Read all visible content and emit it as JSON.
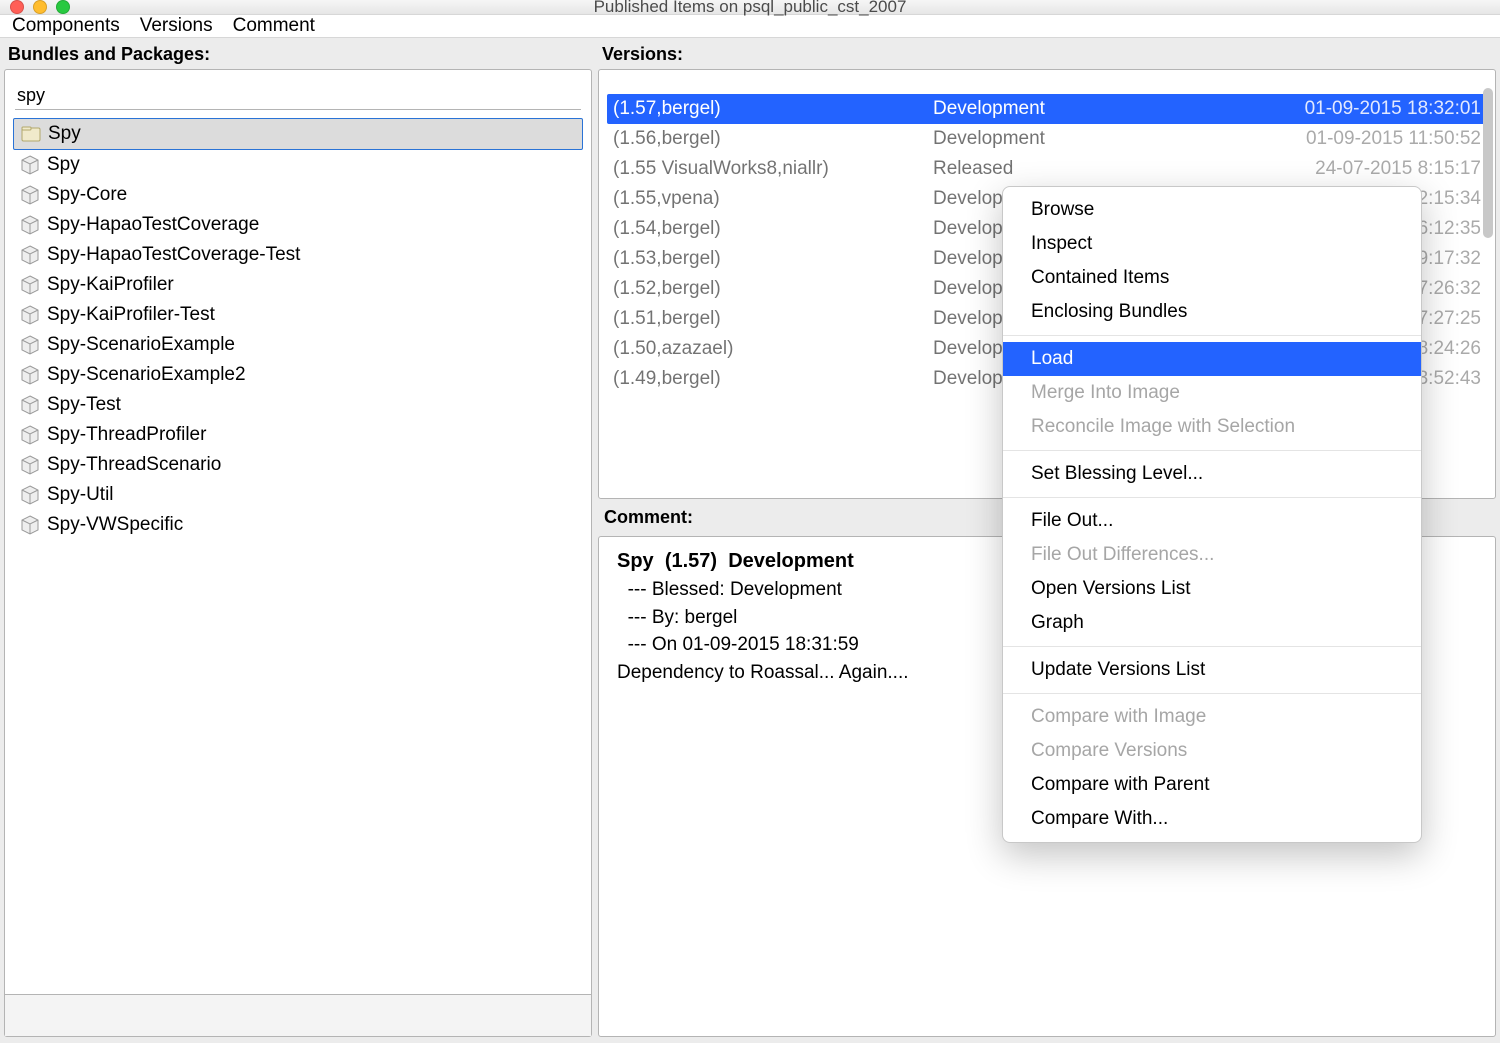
{
  "window": {
    "title": "Published Items on psql_public_cst_2007"
  },
  "menubar": [
    "Components",
    "Versions",
    "Comment"
  ],
  "labels": {
    "bundles": "Bundles and Packages:",
    "versions": "Versions:",
    "comment": "Comment:"
  },
  "search": {
    "value": "spy"
  },
  "packages": [
    {
      "name": "Spy",
      "type": "bundle",
      "selected": true
    },
    {
      "name": "Spy",
      "type": "package"
    },
    {
      "name": "Spy-Core",
      "type": "package"
    },
    {
      "name": "Spy-HapaoTestCoverage",
      "type": "package"
    },
    {
      "name": "Spy-HapaoTestCoverage-Test",
      "type": "package"
    },
    {
      "name": "Spy-KaiProfiler",
      "type": "package"
    },
    {
      "name": "Spy-KaiProfiler-Test",
      "type": "package"
    },
    {
      "name": "Spy-ScenarioExample",
      "type": "package"
    },
    {
      "name": "Spy-ScenarioExample2",
      "type": "package"
    },
    {
      "name": "Spy-Test",
      "type": "package"
    },
    {
      "name": "Spy-ThreadProfiler",
      "type": "package"
    },
    {
      "name": "Spy-ThreadScenario",
      "type": "package"
    },
    {
      "name": "Spy-Util",
      "type": "package"
    },
    {
      "name": "Spy-VWSpecific",
      "type": "package"
    }
  ],
  "versions": [
    {
      "label": "(1.57,bergel)",
      "blessing": "Development",
      "timestamp": "01-09-2015 18:32:01",
      "selected": true,
      "behind": false
    },
    {
      "label": "(1.56,bergel)",
      "blessing": "Development",
      "timestamp": "01-09-2015 11:50:52",
      "behind": true
    },
    {
      "label": "(1.55 VisualWorks8,niallr)",
      "blessing": "Released",
      "timestamp": "24-07-2015 8:15:17",
      "behind": true
    },
    {
      "label": "(1.55,vpena)",
      "blessing": "Development",
      "timestamp": "10-06-2013 12:15:34",
      "behind": true
    },
    {
      "label": "(1.54,bergel)",
      "blessing": "Development",
      "timestamp": "06-05-2013 16:12:35",
      "behind": true
    },
    {
      "label": "(1.53,bergel)",
      "blessing": "Development",
      "timestamp": "06-05-2013 19:17:32",
      "behind": true
    },
    {
      "label": "(1.52,bergel)",
      "blessing": "Development",
      "timestamp": "03-05-2013 17:26:32",
      "behind": true
    },
    {
      "label": "(1.51,bergel)",
      "blessing": "Development",
      "timestamp": "26-04-2013 17:27:25",
      "behind": true
    },
    {
      "label": "(1.50,azazael)",
      "blessing": "Development",
      "timestamp": "23-04-2013 18:24:26",
      "behind": true
    },
    {
      "label": "(1.49,bergel)",
      "blessing": "Development",
      "timestamp": "20-04-2013 13:52:43",
      "behind": true
    }
  ],
  "comment": {
    "name": "Spy",
    "version": "(1.57)",
    "blessing": "Development",
    "blessed_line": "--- Blessed: Development",
    "by_line": "--- By: bergel",
    "on_line": "--- On 01-09-2015 18:31:59",
    "body": "Dependency to Roassal... Again...."
  },
  "context_menu": [
    {
      "label": "Browse",
      "enabled": true,
      "selected": false
    },
    {
      "label": "Inspect",
      "enabled": true
    },
    {
      "label": "Contained Items",
      "enabled": true
    },
    {
      "label": "Enclosing Bundles",
      "enabled": true
    },
    {
      "sep": true
    },
    {
      "label": "Load",
      "enabled": true,
      "selected": true
    },
    {
      "label": "Merge Into Image",
      "enabled": false
    },
    {
      "label": "Reconcile Image with Selection",
      "enabled": false
    },
    {
      "sep": true
    },
    {
      "label": "Set Blessing Level...",
      "enabled": true
    },
    {
      "sep": true
    },
    {
      "label": "File Out...",
      "enabled": true
    },
    {
      "label": "File Out Differences...",
      "enabled": false
    },
    {
      "label": "Open Versions List",
      "enabled": true
    },
    {
      "label": "Graph",
      "enabled": true
    },
    {
      "sep": true
    },
    {
      "label": "Update Versions List",
      "enabled": true
    },
    {
      "sep": true
    },
    {
      "label": "Compare with Image",
      "enabled": false
    },
    {
      "label": "Compare Versions",
      "enabled": false
    },
    {
      "label": "Compare with Parent",
      "enabled": true
    },
    {
      "label": "Compare With...",
      "enabled": true
    }
  ]
}
